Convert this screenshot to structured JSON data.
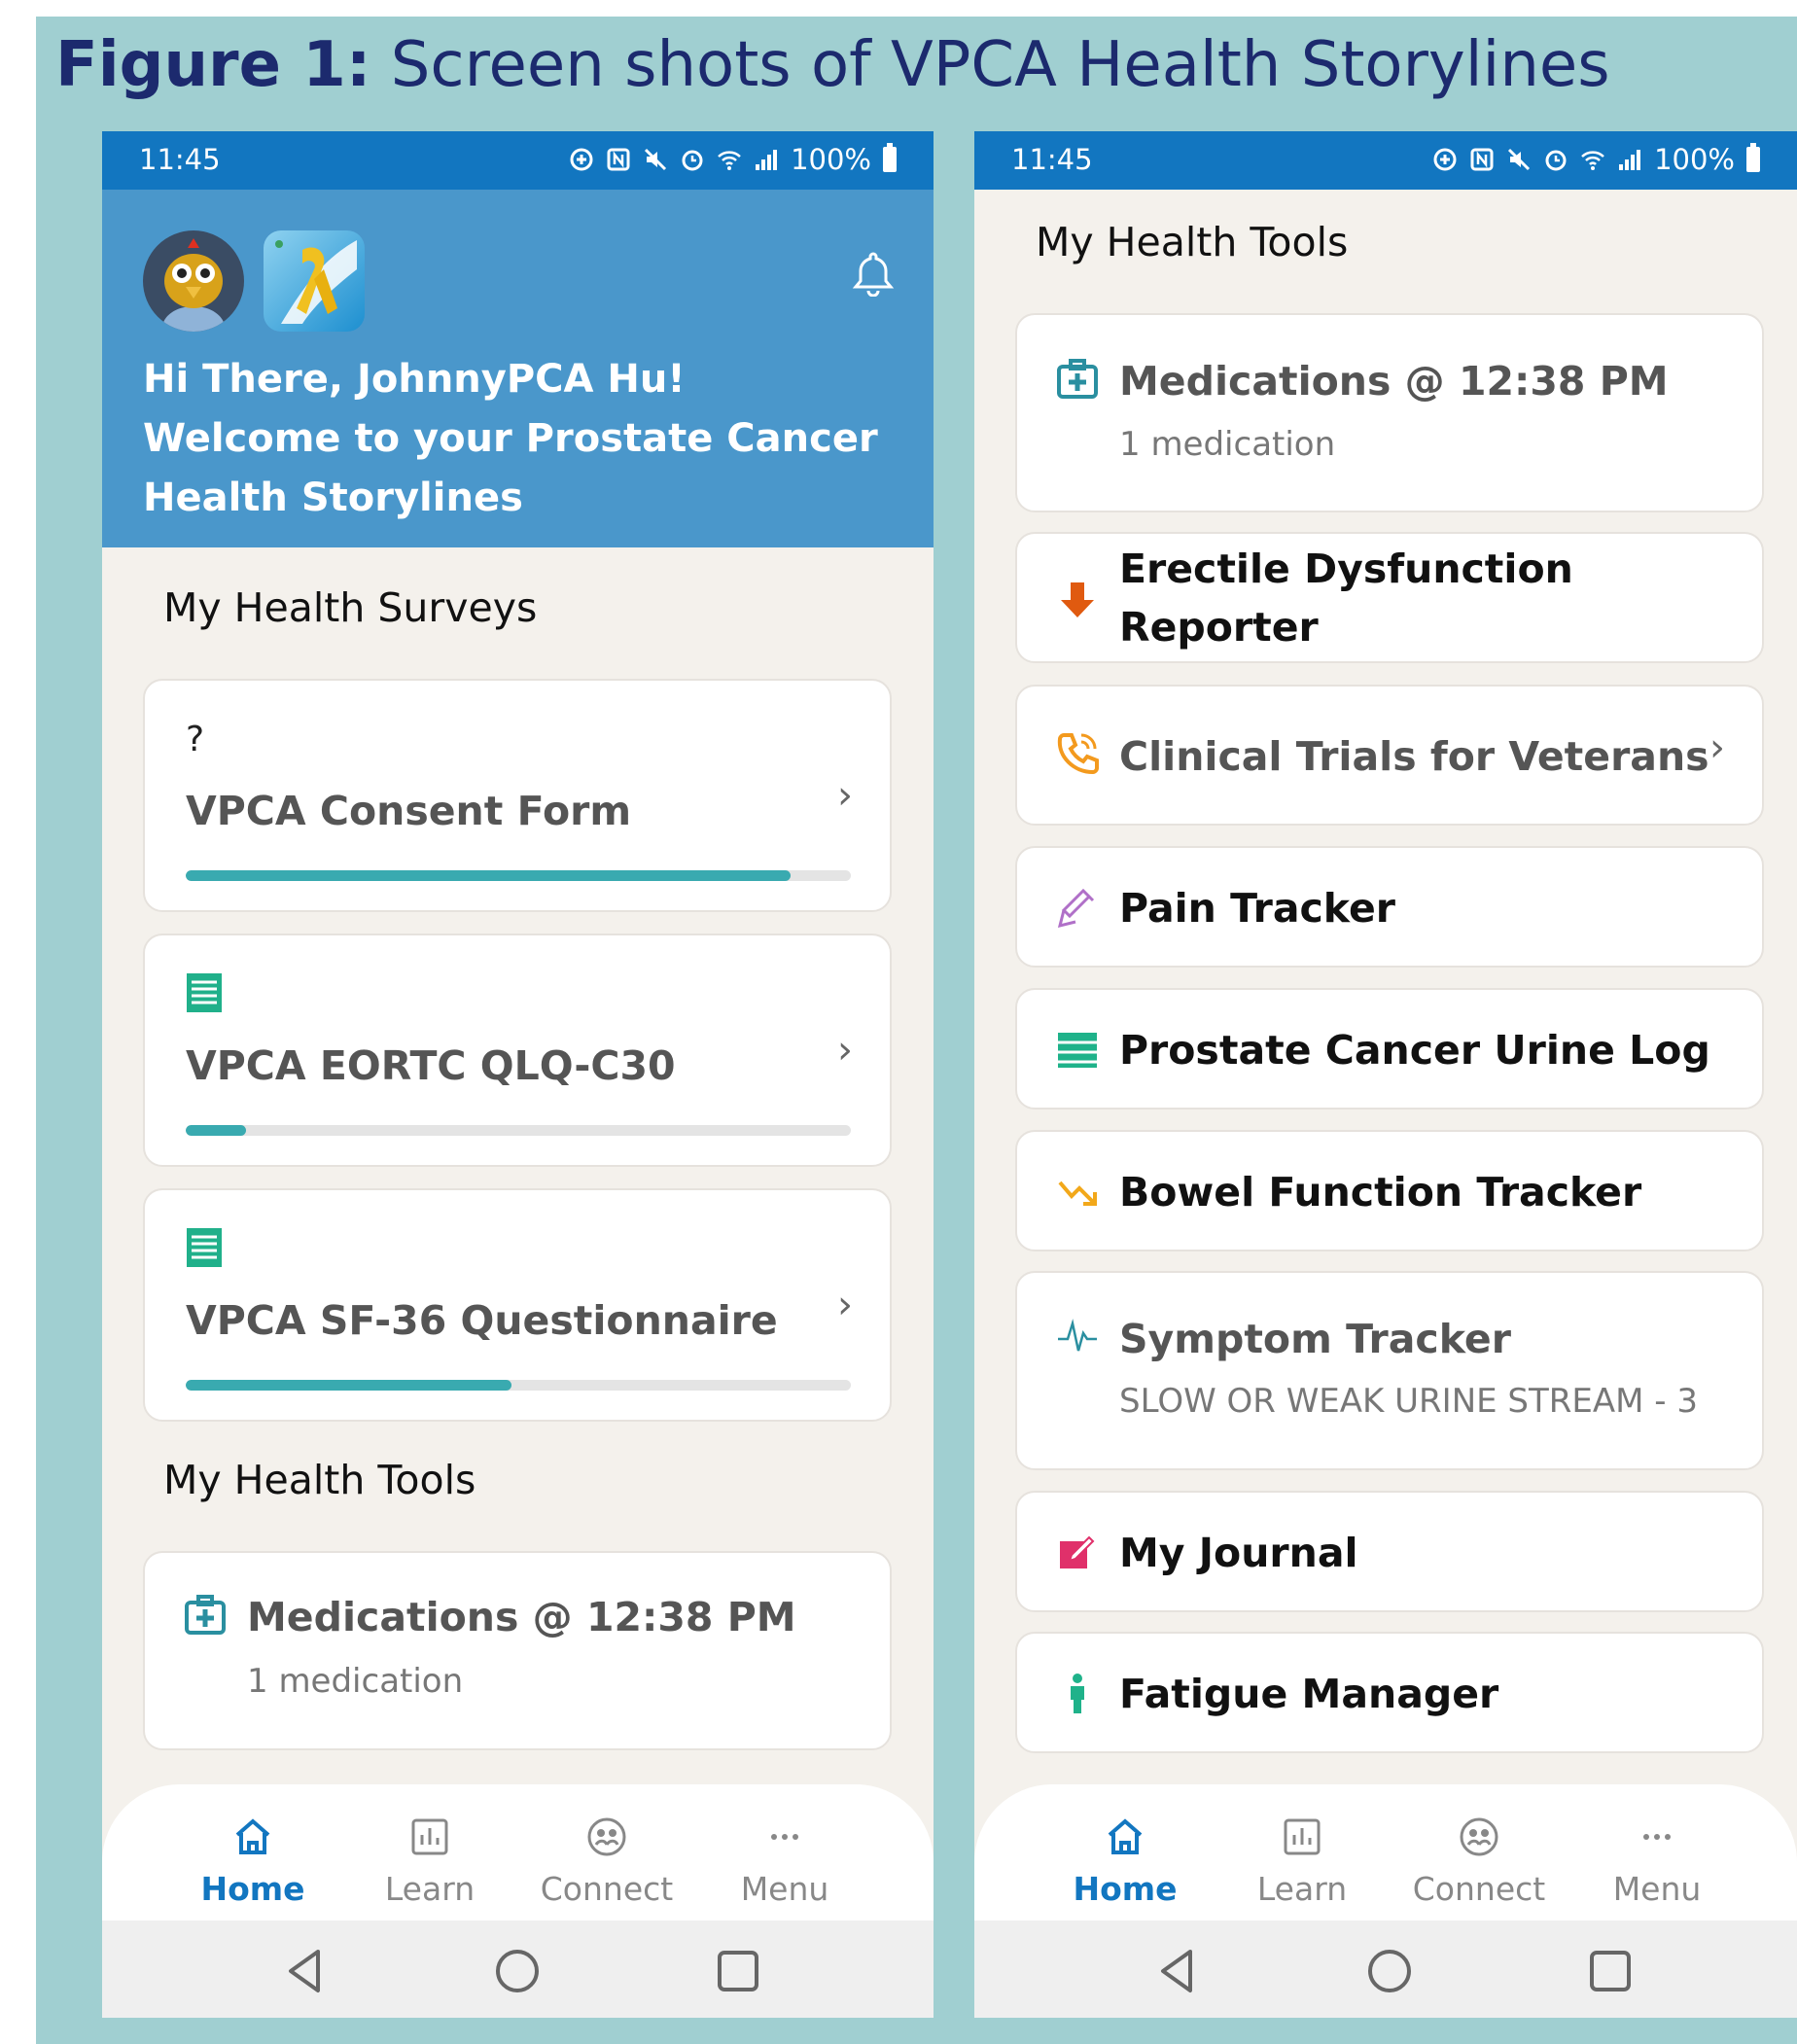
{
  "figure": {
    "label": "Figure 1:",
    "caption": "Screen shots of VPCA Health Storylines"
  },
  "status_bar": {
    "time": "11:45",
    "battery": "100%"
  },
  "left_screen": {
    "greeting_line1": "Hi There, JohnnyPCA Hu!",
    "greeting_line2": "Welcome to your Prostate Cancer",
    "greeting_line3": "Health Storylines",
    "surveys_title": "My Health Surveys",
    "surveys": [
      {
        "label": "VPCA Consent Form",
        "icon": "question-icon",
        "icon_text": "?",
        "progress": 0.91
      },
      {
        "label": "VPCA EORTC QLQ-C30",
        "icon": "document-icon",
        "progress": 0.09
      },
      {
        "label": "VPCA SF-36 Questionnaire",
        "icon": "document-icon",
        "progress": 0.49
      }
    ],
    "tools_title": "My Health Tools",
    "medications": {
      "title": "Medications @ 12:38 PM",
      "subtitle": "1 medication"
    }
  },
  "right_screen": {
    "tools_title": "My Health Tools",
    "tools": [
      {
        "title": "Medications @ 12:38 PM",
        "subtitle": "1 medication",
        "icon": "medical-kit-icon",
        "color": "#2a8fa0"
      },
      {
        "title_line1": "Erectile Dysfunction",
        "title_line2": "Reporter",
        "icon": "down-arrow-icon",
        "color": "#e05a10"
      },
      {
        "title": "Clinical Trials for Veterans",
        "icon": "phone-icon",
        "color": "#f39a1e"
      },
      {
        "title": "Pain Tracker",
        "icon": "syringe-icon",
        "color": "#b070c8"
      },
      {
        "title": "Prostate Cancer Urine Log",
        "icon": "list-icon",
        "color": "#1fb28a"
      },
      {
        "title": "Bowel Function Tracker",
        "icon": "trend-down-icon",
        "color": "#f2a81a"
      },
      {
        "title": "Symptom Tracker",
        "subtitle": "SLOW OR WEAK URINE STREAM - 3",
        "icon": "pulse-icon",
        "color": "#2a8fa0"
      },
      {
        "title": "My Journal",
        "icon": "journal-icon",
        "color": "#e0306a"
      },
      {
        "title": "Fatigue Manager",
        "icon": "person-icon",
        "color": "#1fb28a"
      }
    ]
  },
  "tabbar": {
    "tabs": [
      {
        "label": "Home",
        "icon": "home-icon",
        "active": true
      },
      {
        "label": "Learn",
        "icon": "chart-icon",
        "active": false
      },
      {
        "label": "Connect",
        "icon": "connect-icon",
        "active": false
      },
      {
        "label": "Menu",
        "icon": "more-icon",
        "active": false
      }
    ]
  },
  "colors": {
    "accent": "#1276c0",
    "header": "#4a97cb",
    "progress": "#39aab0",
    "background": "#a0cfd1"
  }
}
